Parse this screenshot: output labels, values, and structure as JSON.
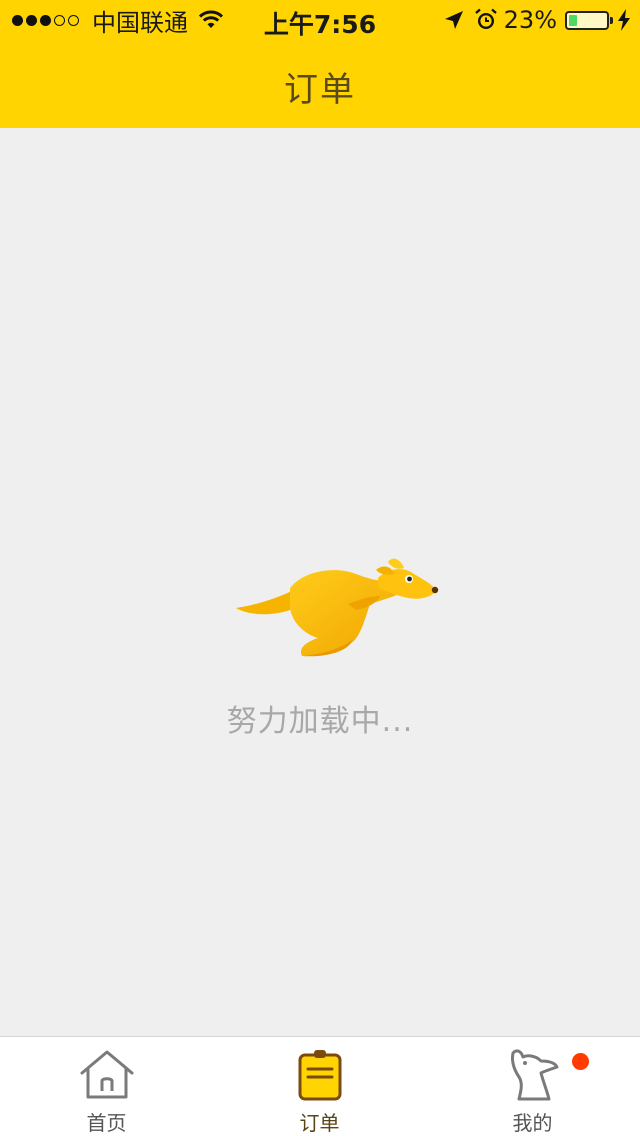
{
  "status_bar": {
    "signal_dots": [
      "full",
      "full",
      "full",
      "empty",
      "empty"
    ],
    "carrier": "中国联通",
    "wifi_icon": "wifi-icon",
    "time": "上午7:56",
    "location_icon": "location-arrow-icon",
    "alarm_icon": "alarm-icon",
    "battery_percent": "23%",
    "battery_level": 0.23,
    "charging_icon": "charging-bolt-icon"
  },
  "header": {
    "title": "订单",
    "background_color": "#ffd400"
  },
  "main": {
    "loading_icon": "kangaroo-icon",
    "loading_text": "努力加载中..."
  },
  "tab_bar": {
    "tabs": [
      {
        "label": "首页",
        "icon": "home-icon",
        "active": false
      },
      {
        "label": "订单",
        "icon": "order-clipboard-icon",
        "active": true
      },
      {
        "label": "我的",
        "icon": "kangaroo-profile-icon",
        "active": false,
        "badge": true
      }
    ],
    "badge_color": "#ff3b00",
    "active_icon_color": "#ffd400"
  }
}
